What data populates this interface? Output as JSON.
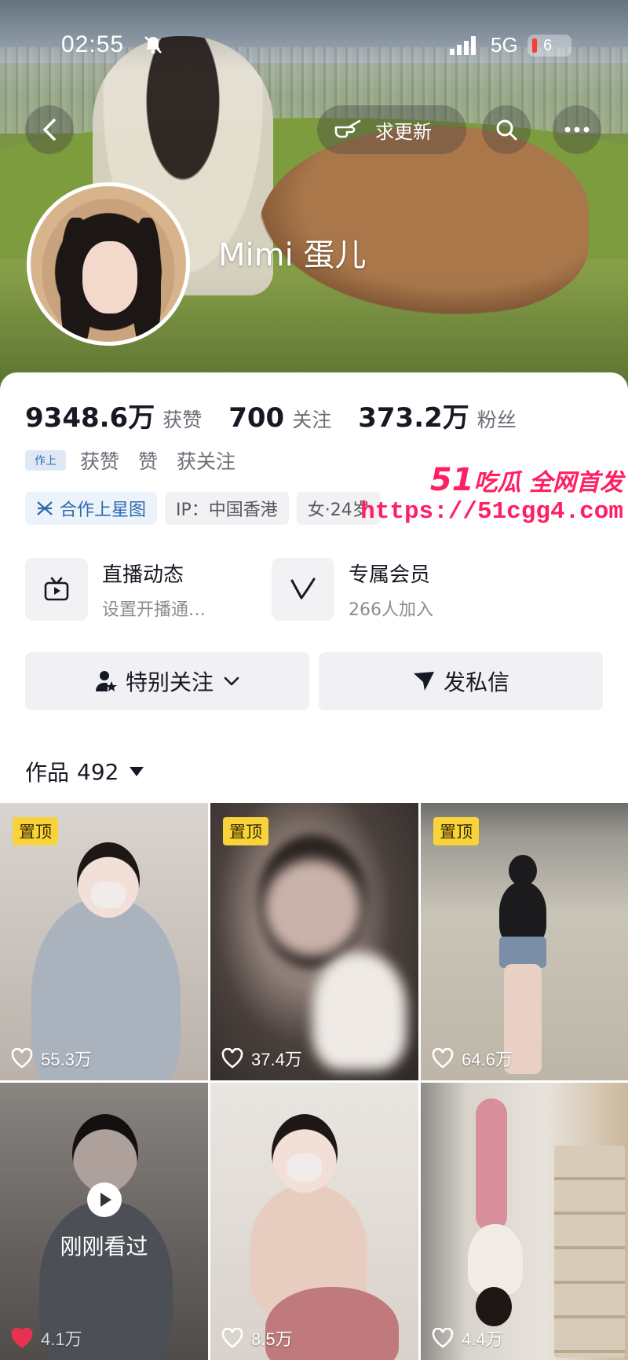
{
  "status_bar": {
    "time": "02:55",
    "network": "5G",
    "battery": "6"
  },
  "header": {
    "update_button_label": "求更新",
    "username": "Mimi 蛋儿"
  },
  "stats": [
    {
      "value": "9348.6万",
      "label": "获赞"
    },
    {
      "value": "700",
      "label": "关注"
    },
    {
      "value": "373.2万",
      "label": "粉丝"
    }
  ],
  "sub_row": {
    "badge": "作上",
    "text1": "获赞",
    "text2": "赞",
    "text3": "获关注"
  },
  "tags": {
    "star": "合作上星图",
    "ip": "IP：中国香港",
    "gender_age": "女·24岁"
  },
  "watermark": {
    "brand_num": "51",
    "brand_text": "吃瓜 全网首发",
    "url": "https://51cgg4.com"
  },
  "features": {
    "live": {
      "title": "直播动态",
      "subtitle": "设置开播通…"
    },
    "vip": {
      "title": "专属会员",
      "subtitle": "266人加入"
    }
  },
  "actions": {
    "follow": "特别关注",
    "message": "发私信"
  },
  "works": {
    "label": "作品",
    "count": "492"
  },
  "grid": [
    {
      "pinned": "置顶",
      "likes": "55.3万"
    },
    {
      "pinned": "置顶",
      "likes": "37.4万"
    },
    {
      "pinned": "置顶",
      "likes": "64.6万"
    },
    {
      "viewed": "刚刚看过",
      "likes": "4.1万"
    },
    {
      "likes": "8.5万"
    },
    {
      "likes": "4.4万"
    }
  ],
  "colors": {
    "accent_pink": "#ff1f63",
    "pin_yellow": "#f8d33a",
    "text_primary": "#161823",
    "text_secondary": "#6b6e76"
  },
  "icons": [
    "bell-off-icon",
    "signal-icon",
    "back-icon",
    "hand-point-icon",
    "search-icon",
    "more-icon",
    "star-map-icon",
    "tv-icon",
    "vip-v-icon",
    "user-star-icon",
    "chevron-down-icon",
    "send-icon",
    "heart-icon",
    "play-icon"
  ]
}
